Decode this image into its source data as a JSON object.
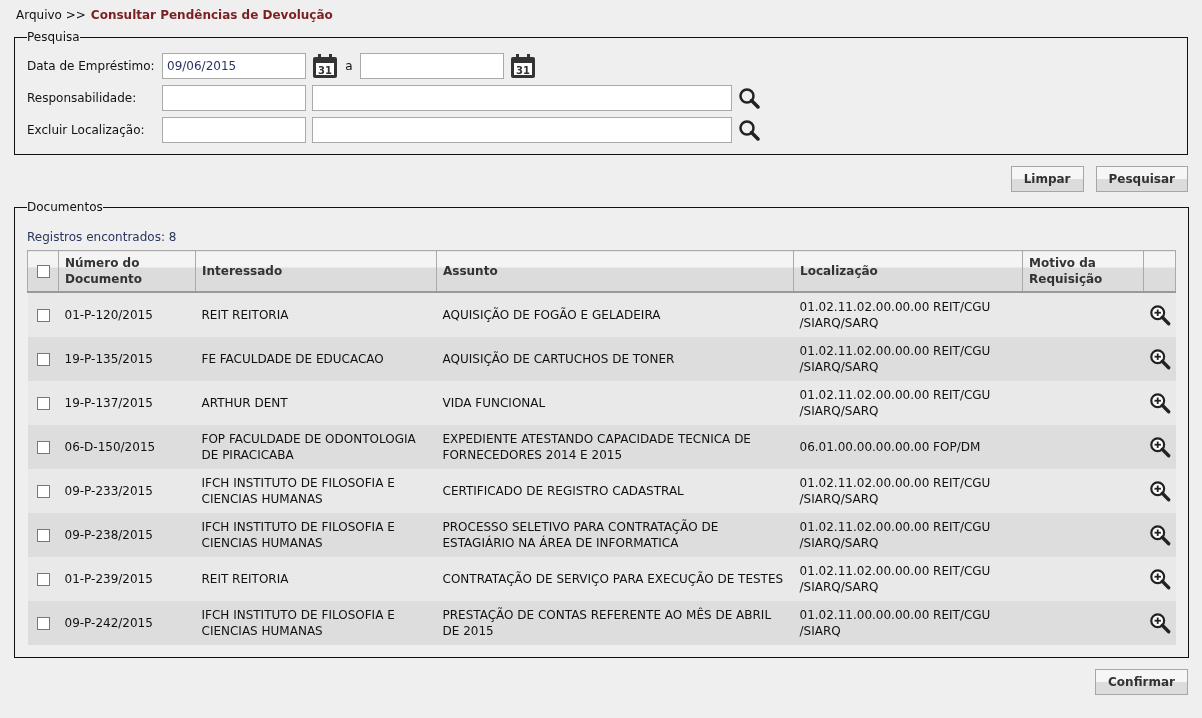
{
  "breadcrumb": {
    "parent": "Arquivo >>",
    "current": "Consultar Pendências de Devolução"
  },
  "search": {
    "legend": "Pesquisa",
    "loan_date": {
      "label": "Data de Empréstimo:",
      "from": "09/06/2015",
      "from_calendar_day": "31",
      "separator": "a",
      "to_calendar_day": "31"
    },
    "fields": [
      {
        "label": "Responsabilidade:"
      },
      {
        "label": "Excluir Localização:"
      }
    ]
  },
  "actions": [
    "Limpar",
    "Pesquisar"
  ],
  "documents": {
    "legend": "Documentos",
    "count": "Registros encontrados: 8",
    "select_all": {
      "checked": false
    },
    "columns": [
      "Número do Documento",
      "Interessado",
      "Assunto",
      "Localização",
      "Motivo da Requisição"
    ],
    "rows": [
      {
        "checked": false,
        "number": "01-P-120/2015",
        "interested": "REIT REITORIA",
        "subject": "AQUISIÇÃO DE FOGÃO E GELADEIRA",
        "location": "01.02.11.02.00.00.00 REIT/CGU /SIARQ/SARQ"
      },
      {
        "checked": false,
        "number": "19-P-135/2015",
        "interested": "FE FACULDADE DE EDUCACAO",
        "subject": "AQUISIÇÃO DE CARTUCHOS DE TONER",
        "location": "01.02.11.02.00.00.00 REIT/CGU /SIARQ/SARQ"
      },
      {
        "checked": false,
        "number": "19-P-137/2015",
        "interested": "ARTHUR DENT",
        "subject": "VIDA FUNCIONAL",
        "location": "01.02.11.02.00.00.00 REIT/CGU /SIARQ/SARQ"
      },
      {
        "checked": false,
        "number": "06-D-150/2015",
        "interested": "FOP FACULDADE DE ODONTOLOGIA DE PIRACICABA",
        "subject": "EXPEDIENTE ATESTANDO CAPACIDADE TECNICA DE FORNECEDORES 2014 E 2015",
        "location": "06.01.00.00.00.00.00 FOP/DM"
      },
      {
        "checked": false,
        "number": "09-P-233/2015",
        "interested": "IFCH INSTITUTO DE FILOSOFIA E CIENCIAS HUMANAS",
        "subject": "CERTIFICADO DE REGISTRO CADASTRAL",
        "location": "01.02.11.02.00.00.00 REIT/CGU /SIARQ/SARQ"
      },
      {
        "checked": false,
        "number": "09-P-238/2015",
        "interested": "IFCH INSTITUTO DE FILOSOFIA E CIENCIAS HUMANAS",
        "subject": "PROCESSO SELETIVO PARA CONTRATAÇÃO DE ESTAGIÁRIO NA ÁREA DE INFORMATICA",
        "location": "01.02.11.02.00.00.00 REIT/CGU /SIARQ/SARQ"
      },
      {
        "checked": false,
        "number": "01-P-239/2015",
        "interested": "REIT REITORIA",
        "subject": "CONTRATAÇÃO DE SERVIÇO PARA EXECUÇÃO DE TESTES",
        "location": "01.02.11.02.00.00.00 REIT/CGU /SIARQ/SARQ"
      },
      {
        "checked": false,
        "number": "09-P-242/2015",
        "interested": "IFCH INSTITUTO DE FILOSOFIA E CIENCIAS HUMANAS",
        "subject": "PRESTAÇÃO DE CONTAS REFERENTE AO MÊS DE ABRIL DE 2015",
        "location": "01.02.11.00.00.00.00 REIT/CGU /SIARQ"
      }
    ]
  },
  "confirm": "Confirmar"
}
